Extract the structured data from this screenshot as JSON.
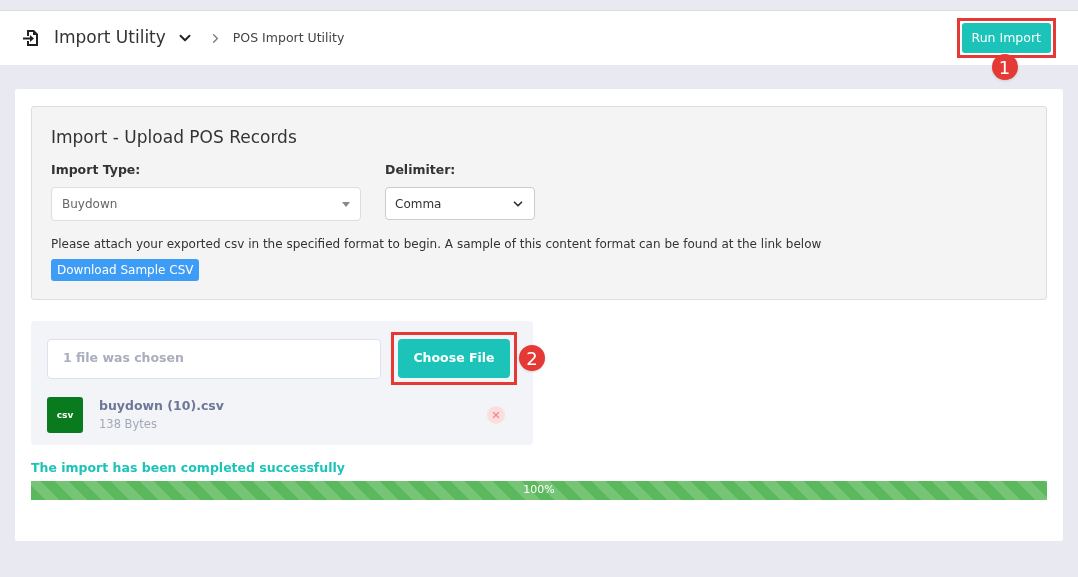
{
  "header": {
    "title": "Import Utility",
    "breadcrumb": "POS Import Utility",
    "action": "Run Import",
    "action_callout": "1"
  },
  "panel": {
    "title": "Import - Upload POS Records",
    "import_type": {
      "label": "Import Type:",
      "value": "Buydown"
    },
    "delimiter": {
      "label": "Delimiter:",
      "value": "Comma"
    },
    "instructions": "Please attach your exported csv in the specified format to begin. A sample of this content format can be found at the link below",
    "download": "Download Sample CSV"
  },
  "upload": {
    "field_value": "1 file was chosen",
    "button": "Choose File",
    "button_callout": "2",
    "files": [
      {
        "badge": "csv",
        "name": "buydown (10).csv",
        "size": "138 Bytes"
      }
    ]
  },
  "status": {
    "message": "The import has been completed successfully",
    "level": 1,
    "reading": "100%"
  }
}
